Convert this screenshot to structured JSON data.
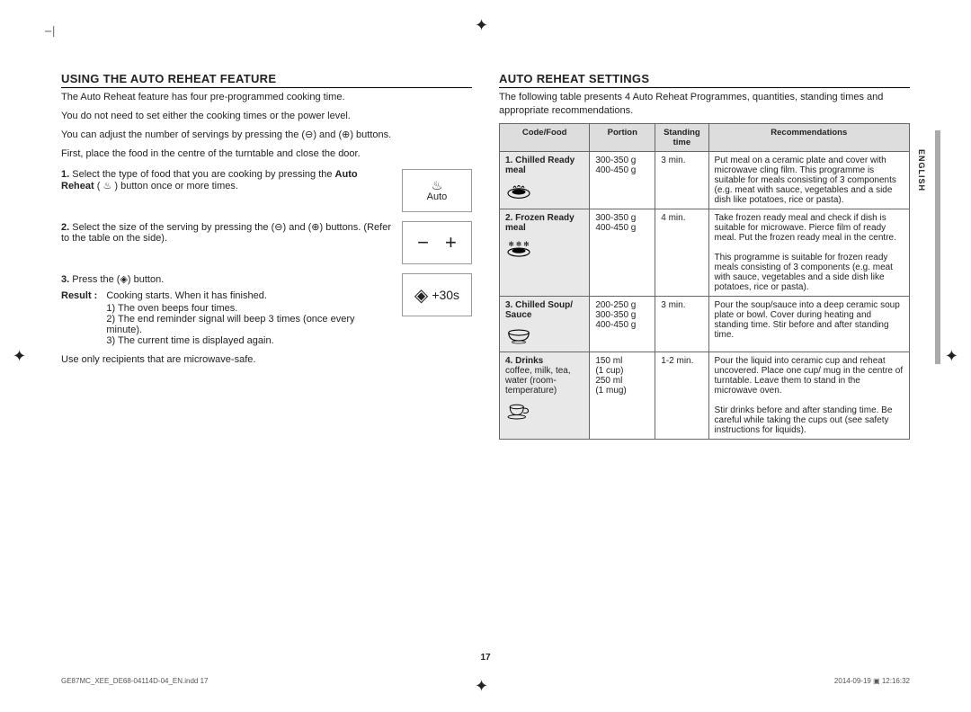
{
  "left": {
    "heading": "USING THE AUTO REHEAT FEATURE",
    "intro1": "The Auto Reheat feature has four pre-programmed cooking time.",
    "intro2": "You do not need to set either the cooking times or the power level.",
    "intro3_a": "You can adjust the number of servings by pressing the (",
    "intro3_b": ") and (",
    "intro3_c": ") buttons.",
    "intro4": "First, place the food in the centre of the turntable and close the door.",
    "step1_num": "1.",
    "step1_a": "Select the type of food that you are cooking by pressing the ",
    "step1_bold": "Auto Reheat",
    "step1_b": " ( ",
    "step1_c": " ) button once or more times.",
    "step2_num": "2.",
    "step2_a": "Select the size of the serving by pressing the (",
    "step2_b": ") and (",
    "step2_c": ") buttons. (Refer to the table on the side).",
    "step3_num": "3.",
    "step3_a": "Press the (",
    "step3_b": ") button.",
    "result_label": "Result :",
    "result_text": "Cooking starts. When it has finished.",
    "r1": "1) The oven beeps four times.",
    "r2": "2) The end reminder signal will beep 3 times (once every minute).",
    "r3": "3) The current time is displayed again.",
    "safe": "Use only recipients that are microwave-safe.",
    "auto_label": "Auto",
    "plus30s": "+30s"
  },
  "right": {
    "heading": "AUTO REHEAT SETTINGS",
    "intro": "The following table presents 4 Auto Reheat Programmes, quantities, standing times and appropriate recommendations.",
    "headers": {
      "code": "Code/Food",
      "portion": "Portion",
      "standing": "Standing time",
      "rec": "Recommendations"
    },
    "rows": [
      {
        "code": "1. Chilled Ready meal",
        "portion": "300-350 g\n400-450 g",
        "standing": "3 min.",
        "rec": "Put meal on a ceramic plate and cover with microwave cling film. This programme is suitable for meals consisting of 3 components (e.g. meat with sauce, vegetables and a side dish like potatoes, rice or pasta).",
        "icon": "plate"
      },
      {
        "code": "2. Frozen Ready meal",
        "portion": "300-350 g\n400-450 g",
        "standing": "4 min.",
        "rec": "Take frozen ready meal and check if dish is suitable for microwave. Pierce film of ready meal. Put the frozen ready meal in the centre.\nThis programme is suitable for frozen ready meals consisting of 3 components (e.g. meat with sauce, vegetables and a side dish like potatoes, rice or pasta).",
        "icon": "frozen"
      },
      {
        "code": "3. Chilled Soup/ Sauce",
        "portion": "200-250 g\n300-350 g\n400-450 g",
        "standing": "3 min.",
        "rec": "Pour the soup/sauce into a deep ceramic soup plate or bowl. Cover during heating and standing time. Stir before and after standing time.",
        "icon": "bowl"
      },
      {
        "code": "4. Drinks",
        "code_sub": "coffee, milk, tea, water (room-temperature)",
        "portion": "150 ml\n(1 cup)\n250 ml\n(1 mug)",
        "standing": "1-2 min.",
        "rec": "Pour the liquid into ceramic cup and reheat uncovered. Place one cup/ mug in the centre of turntable. Leave them to stand in the microwave oven.\nStir drinks before and after standing time. Be careful while taking the cups out (see safety instructions for liquids).",
        "icon": "cup"
      }
    ]
  },
  "side_tab": "ENGLISH",
  "page_number": "17",
  "footer_left": "GE87MC_XEE_DE68-04114D-04_EN.indd   17",
  "footer_right": "2014-09-19   ▣ 12:16:32",
  "symbols": {
    "minus": "⊖",
    "plus": "⊕",
    "start": "◈"
  }
}
